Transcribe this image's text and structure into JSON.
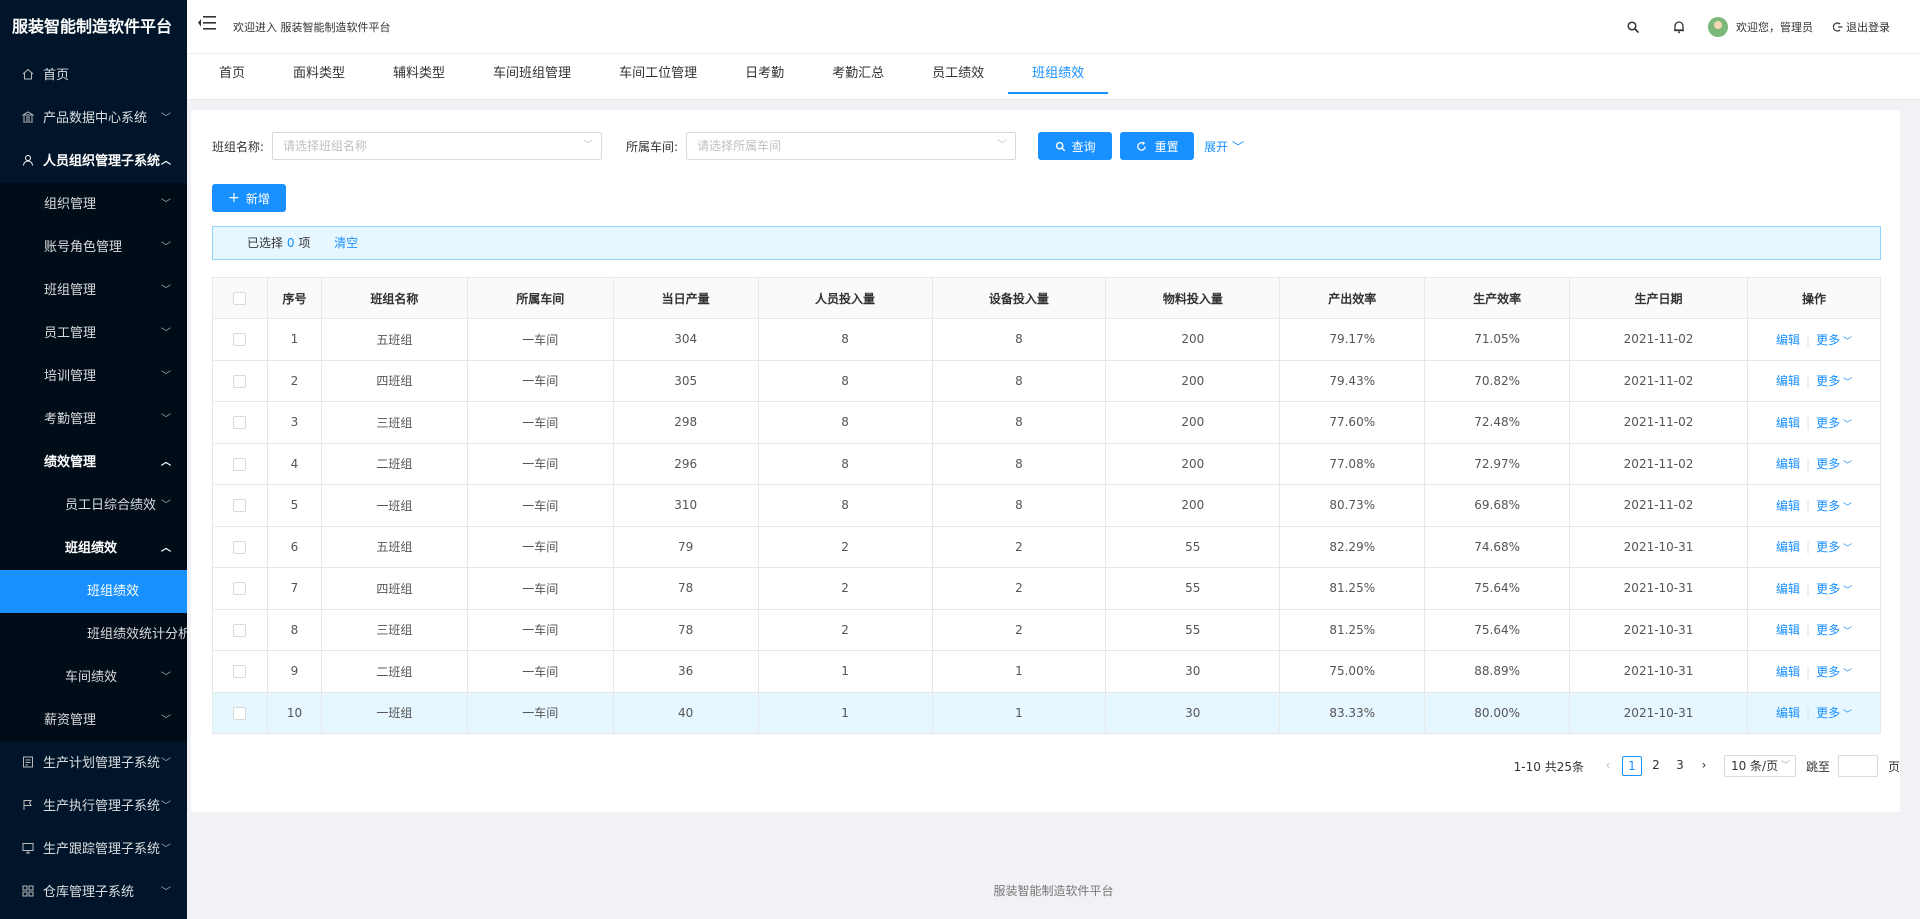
{
  "app": {
    "title": "服装智能制造软件平台"
  },
  "header": {
    "welcome": "欢迎进入 服装智能制造软件平台",
    "user_greeting": "欢迎您，管理员",
    "logout": "退出登录"
  },
  "sidebar": {
    "items": [
      {
        "label": "首页",
        "level": 1,
        "icon": "home-icon",
        "arrow": ""
      },
      {
        "label": "产品数据中心系统",
        "level": 1,
        "icon": "bank-icon",
        "arrow": "down"
      },
      {
        "label": "人员组织管理子系统",
        "level": 1,
        "icon": "user-icon",
        "arrow": "up",
        "bold": true
      },
      {
        "label": "组织管理",
        "level": 2,
        "arrow": "down"
      },
      {
        "label": "账号角色管理",
        "level": 2,
        "arrow": "down"
      },
      {
        "label": "班组管理",
        "level": 2,
        "arrow": "down"
      },
      {
        "label": "员工管理",
        "level": 2,
        "arrow": "down"
      },
      {
        "label": "培训管理",
        "level": 2,
        "arrow": "down"
      },
      {
        "label": "考勤管理",
        "level": 2,
        "arrow": "down"
      },
      {
        "label": "绩效管理",
        "level": 2,
        "arrow": "up",
        "bold": true
      },
      {
        "label": "员工日综合绩效",
        "level": 3,
        "arrow": "down"
      },
      {
        "label": "班组绩效",
        "level": 3,
        "arrow": "up",
        "bold": true
      },
      {
        "label": "班组绩效",
        "level": 4,
        "arrow": "",
        "active": true
      },
      {
        "label": "班组绩效统计分析",
        "level": 4,
        "arrow": ""
      },
      {
        "label": "车间绩效",
        "level": 3,
        "arrow": "down"
      },
      {
        "label": "薪资管理",
        "level": 2,
        "arrow": "down"
      },
      {
        "label": "生产计划管理子系统",
        "level": 1,
        "icon": "plan-icon",
        "arrow": "down"
      },
      {
        "label": "生产执行管理子系统",
        "level": 1,
        "icon": "flag-icon",
        "arrow": "down"
      },
      {
        "label": "生产跟踪管理子系统",
        "level": 1,
        "icon": "monitor-icon",
        "arrow": "down"
      },
      {
        "label": "仓库管理子系统",
        "level": 1,
        "icon": "grid-icon",
        "arrow": "down"
      }
    ]
  },
  "tabs": [
    {
      "label": "首页"
    },
    {
      "label": "面料类型"
    },
    {
      "label": "辅料类型"
    },
    {
      "label": "车间班组管理"
    },
    {
      "label": "车间工位管理"
    },
    {
      "label": "日考勤"
    },
    {
      "label": "考勤汇总"
    },
    {
      "label": "员工绩效"
    },
    {
      "label": "班组绩效",
      "active": true
    }
  ],
  "filters": {
    "team_label": "班组名称:",
    "team_placeholder": "请选择班组名称",
    "workshop_label": "所属车间:",
    "workshop_placeholder": "请选择所属车间",
    "query": "查询",
    "reset": "重置",
    "expand": "展开"
  },
  "toolbar": {
    "add": "新增"
  },
  "selection": {
    "prefix": "已选择",
    "count": "0",
    "suffix": "项",
    "clear": "清空"
  },
  "table": {
    "headers": [
      "序号",
      "班组名称",
      "所属车间",
      "当日产量",
      "人员投入量",
      "设备投入量",
      "物料投入量",
      "产出效率",
      "生产效率",
      "生产日期",
      "操作"
    ],
    "rows": [
      [
        "1",
        "五班组",
        "一车间",
        "304",
        "8",
        "8",
        "200",
        "79.17%",
        "71.05%",
        "2021-11-02"
      ],
      [
        "2",
        "四班组",
        "一车间",
        "305",
        "8",
        "8",
        "200",
        "79.43%",
        "70.82%",
        "2021-11-02"
      ],
      [
        "3",
        "三班组",
        "一车间",
        "298",
        "8",
        "8",
        "200",
        "77.60%",
        "72.48%",
        "2021-11-02"
      ],
      [
        "4",
        "二班组",
        "一车间",
        "296",
        "8",
        "8",
        "200",
        "77.08%",
        "72.97%",
        "2021-11-02"
      ],
      [
        "5",
        "一班组",
        "一车间",
        "310",
        "8",
        "8",
        "200",
        "80.73%",
        "69.68%",
        "2021-11-02"
      ],
      [
        "6",
        "五班组",
        "一车间",
        "79",
        "2",
        "2",
        "55",
        "82.29%",
        "74.68%",
        "2021-10-31"
      ],
      [
        "7",
        "四班组",
        "一车间",
        "78",
        "2",
        "2",
        "55",
        "81.25%",
        "75.64%",
        "2021-10-31"
      ],
      [
        "8",
        "三班组",
        "一车间",
        "78",
        "2",
        "2",
        "55",
        "81.25%",
        "75.64%",
        "2021-10-31"
      ],
      [
        "9",
        "二班组",
        "一车间",
        "36",
        "1",
        "1",
        "30",
        "75.00%",
        "88.89%",
        "2021-10-31"
      ],
      [
        "10",
        "一班组",
        "一车间",
        "40",
        "1",
        "1",
        "30",
        "83.33%",
        "80.00%",
        "2021-10-31"
      ]
    ],
    "edit": "编辑",
    "more": "更多"
  },
  "pagination": {
    "total_text": "1-10 共25条",
    "pages": [
      "1",
      "2",
      "3"
    ],
    "current": "1",
    "page_size": "10 条/页",
    "jump_label": "跳至",
    "page_suffix": "页"
  },
  "footer": {
    "text": "服装智能制造软件平台"
  },
  "colors": {
    "primary": "#1890ff",
    "sidebar_bg": "#001529",
    "highlight_row": "#e6f7ff"
  }
}
